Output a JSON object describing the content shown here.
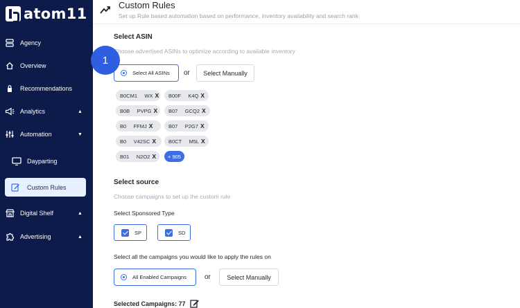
{
  "app": {
    "logo_text": "atom11"
  },
  "sidebar": {
    "items": [
      {
        "label": "Agency",
        "icon": "server-icon"
      },
      {
        "label": "Overview",
        "icon": "home-icon"
      },
      {
        "label": "Recommendations",
        "icon": "lock-icon"
      },
      {
        "label": "Analytics",
        "icon": "megaphone-icon"
      },
      {
        "label": "Automation",
        "icon": "sliders-icon"
      },
      {
        "label": "Dayparting",
        "icon": "monitor-icon"
      },
      {
        "label": "Custom Rules",
        "icon": "edit-icon"
      },
      {
        "label": "Digital Shelf",
        "icon": "store-icon"
      },
      {
        "label": "Advertising",
        "icon": "puzzle-icon"
      }
    ]
  },
  "header": {
    "title": "Custom Rules",
    "subtitle": "Set up Rule based automation based on performance, inventory availability and search rank"
  },
  "asin": {
    "heading": "Select ASIN",
    "description": "Choose advertised ASINs to optimize according to available inventory",
    "select_all_label": "Select All ASINs",
    "or": "or",
    "select_manually_label": "Select Manually",
    "chips": [
      "B0CM1     WX",
      "B00F     K4Q",
      "B0B     PVPG",
      "B07     GCQ2",
      "B0     FFMJ",
      "B07     P2G7",
      "B0     V42SC",
      "B0CT     M5L",
      "B01     N2O2"
    ],
    "chip_remove": "X",
    "more_label": "+ 905"
  },
  "source": {
    "heading": "Select source",
    "description": "Choose campaigns to set up the custom rule",
    "sponsored_type_label": "Select Sponsored Type",
    "types": [
      "SP",
      "SD"
    ],
    "campaigns_label": "Select all the campaigns you would like to apply the rules on",
    "all_enabled_label": "All Enabled Campaigns",
    "or": "or",
    "select_manually_label": "Select Manually",
    "selected_campaigns": "Selected Campaigns: 77"
  },
  "step": {
    "number": "1"
  },
  "colors": {
    "sidebar_bg": "#0d1b4a",
    "accent": "#3c6ee8",
    "step_badge": "#2f5ee0"
  }
}
